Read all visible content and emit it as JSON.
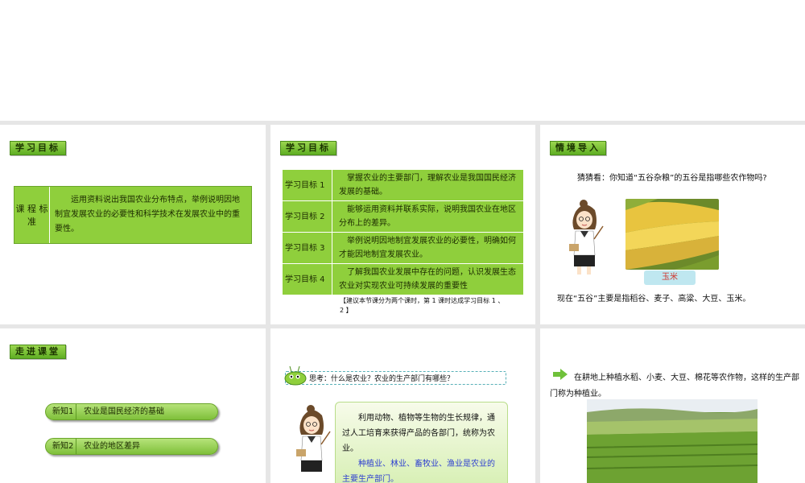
{
  "slides": {
    "s1": {
      "tag": "学习目标",
      "label": "课 程 标 准",
      "text": "运用资料说出我国农业分布特点，举例说明因地制宜发展农业的必要性和科学技术在发展农业中的重要性。"
    },
    "s2": {
      "tag": "学习目标",
      "rows": [
        {
          "k": "学习目标 1",
          "v": "掌握农业的主要部门，理解农业是我国国民经济发展的基础。"
        },
        {
          "k": "学习目标 2",
          "v": "能够运用资料并联系实际，说明我国农业在地区分布上的差异。"
        },
        {
          "k": "学习目标 3",
          "v": "举例说明因地制宜发展农业的必要性，明确如何才能因地制宜发展农业。"
        },
        {
          "k": "学习目标 4",
          "v": "了解我国农业发展中存在的问题，认识发展生态农业对实现农业可持续发展的重要性"
        }
      ],
      "note": "【建议本节课分为两个课时，第 1 课时达成学习目标 1 、 2 】"
    },
    "s3": {
      "tag": "情境导入",
      "question": "猜猜看：你知道“五谷杂粮”的五谷是指哪些农作物吗?",
      "corn_label": "玉米",
      "answer": "现在“五谷”主要是指稻谷、麦子、高粱、大豆、玉米。"
    },
    "s4": {
      "tag": "走进课堂",
      "items": [
        {
          "k": "新知1",
          "v": "农业是国民经济的基础"
        },
        {
          "k": "新知2",
          "v": "农业的地区差异"
        }
      ]
    },
    "s5": {
      "think": "思考：什么是农业？农业的生产部门有哪些？",
      "p1": "利用动物、植物等生物的生长规律，通过人工培育来获得产品的各部门，统称为农业。",
      "p2": "种植业、林业、畜牧业、渔业是农业的主要生产部门。"
    },
    "s6": {
      "text": "在耕地上种植水稻、小麦、大豆、棉花等农作物，这样的生产部门称为种植业。"
    }
  },
  "colors": {
    "table_green": "#8fcf3c",
    "highlight_blue": "#2d3fd0",
    "label_red": "#d0332a"
  }
}
